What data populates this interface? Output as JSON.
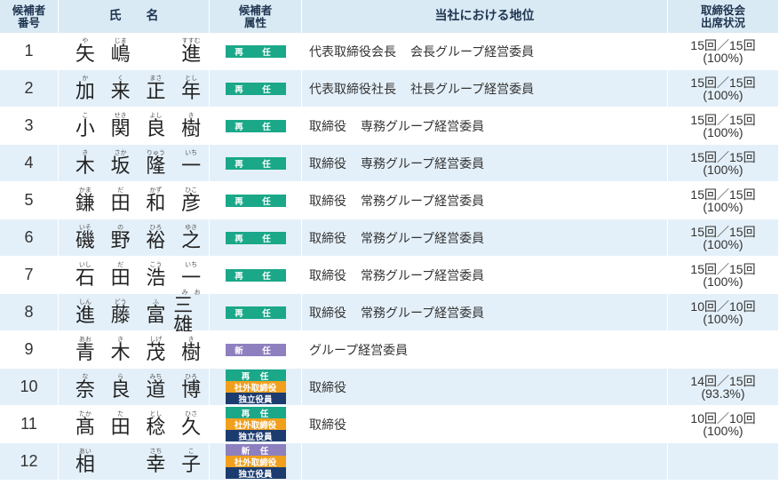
{
  "header": {
    "number_line1": "候補者",
    "number_line2": "番号",
    "name_part1": "氏",
    "name_part2": "名",
    "attr_line1": "候補者",
    "attr_line2": "属性",
    "position": "当社における地位",
    "attendance_line1": "取締役会",
    "attendance_line2": "出席状況"
  },
  "colors": {
    "header_bg": "#d9eaf5",
    "row_alt_bg": "#e4f0f9",
    "reappoint": "#1aa889",
    "new": "#8e7fbf",
    "outside": "#f1a01d",
    "independent": "#1c3c70"
  },
  "rows": [
    {
      "no": "1",
      "name": [
        {
          "k": "矢",
          "r": "や"
        },
        {
          "k": "嶋",
          "r": "じま"
        },
        {
          "k": "",
          "r": ""
        },
        {
          "k": "進",
          "r": "すすむ"
        }
      ],
      "badges": [
        "再　任"
      ],
      "position": [
        "代表取締役会長",
        "会長グループ経営委員"
      ],
      "att1": "15回／15回",
      "att2": "(100%)"
    },
    {
      "no": "2",
      "name": [
        {
          "k": "加",
          "r": "か"
        },
        {
          "k": "来",
          "r": "く"
        },
        {
          "k": "正",
          "r": "まさ"
        },
        {
          "k": "年",
          "r": "とし"
        }
      ],
      "badges": [
        "再　任"
      ],
      "position": [
        "代表取締役社長",
        "社長グループ経営委員"
      ],
      "att1": "15回／15回",
      "att2": "(100%)"
    },
    {
      "no": "3",
      "name": [
        {
          "k": "小",
          "r": "こ"
        },
        {
          "k": "関",
          "r": "せき"
        },
        {
          "k": "良",
          "r": "よし"
        },
        {
          "k": "樹",
          "r": "き"
        }
      ],
      "badges": [
        "再　任"
      ],
      "position": [
        "取締役",
        "専務グループ経営委員"
      ],
      "att1": "15回／15回",
      "att2": "(100%)"
    },
    {
      "no": "4",
      "name": [
        {
          "k": "木",
          "r": "き"
        },
        {
          "k": "坂",
          "r": "さか"
        },
        {
          "k": "隆",
          "r": "りゅう"
        },
        {
          "k": "一",
          "r": "いち"
        }
      ],
      "badges": [
        "再　任"
      ],
      "position": [
        "取締役",
        "専務グループ経営委員"
      ],
      "att1": "15回／15回",
      "att2": "(100%)"
    },
    {
      "no": "5",
      "name": [
        {
          "k": "鎌",
          "r": "かま"
        },
        {
          "k": "田",
          "r": "だ"
        },
        {
          "k": "和",
          "r": "かず"
        },
        {
          "k": "彦",
          "r": "ひこ"
        }
      ],
      "badges": [
        "再　任"
      ],
      "position": [
        "取締役",
        "常務グループ経営委員"
      ],
      "att1": "15回／15回",
      "att2": "(100%)"
    },
    {
      "no": "6",
      "name": [
        {
          "k": "磯",
          "r": "いそ"
        },
        {
          "k": "野",
          "r": "の"
        },
        {
          "k": "裕",
          "r": "ひろ"
        },
        {
          "k": "之",
          "r": "ゆき"
        }
      ],
      "badges": [
        "再　任"
      ],
      "position": [
        "取締役",
        "常務グループ経営委員"
      ],
      "att1": "15回／15回",
      "att2": "(100%)"
    },
    {
      "no": "7",
      "name": [
        {
          "k": "石",
          "r": "いし"
        },
        {
          "k": "田",
          "r": "だ"
        },
        {
          "k": "浩",
          "r": "こう"
        },
        {
          "k": "一",
          "r": "いち"
        }
      ],
      "badges": [
        "再　任"
      ],
      "position": [
        "取締役",
        "常務グループ経営委員"
      ],
      "att1": "15回／15回",
      "att2": "(100%)"
    },
    {
      "no": "8",
      "name": [
        {
          "k": "進",
          "r": "しん"
        },
        {
          "k": "藤",
          "r": "どう"
        },
        {
          "k": "富",
          "r": "ふ"
        },
        {
          "k": "三雄",
          "r": "み　お"
        }
      ],
      "badges": [
        "再　任"
      ],
      "position": [
        "取締役",
        "常務グループ経営委員"
      ],
      "att1": "10回／10回",
      "att2": "(100%)"
    },
    {
      "no": "9",
      "name": [
        {
          "k": "青",
          "r": "あお"
        },
        {
          "k": "木",
          "r": "き"
        },
        {
          "k": "茂",
          "r": "しげ"
        },
        {
          "k": "樹",
          "r": "き"
        }
      ],
      "badges": [
        "新　任"
      ],
      "position": [
        "グループ経営委員"
      ],
      "att1": "",
      "att2": ""
    },
    {
      "no": "10",
      "name": [
        {
          "k": "奈",
          "r": "な"
        },
        {
          "k": "良",
          "r": "ら"
        },
        {
          "k": "道",
          "r": "みち"
        },
        {
          "k": "博",
          "r": "ひろ"
        }
      ],
      "badges": [
        "再　任",
        "社外取締役",
        "独立役員"
      ],
      "position": [
        "取締役"
      ],
      "att1": "14回／15回",
      "att2": "(93.3%)"
    },
    {
      "no": "11",
      "name": [
        {
          "k": "髙",
          "r": "たか"
        },
        {
          "k": "田",
          "r": "た"
        },
        {
          "k": "稔",
          "r": "とし"
        },
        {
          "k": "久",
          "r": "ひさ"
        }
      ],
      "badges": [
        "再　任",
        "社外取締役",
        "独立役員"
      ],
      "position": [
        "取締役"
      ],
      "att1": "10回／10回",
      "att2": "(100%)"
    },
    {
      "no": "12",
      "name": [
        {
          "k": "相",
          "r": "あい"
        },
        {
          "k": "",
          "r": ""
        },
        {
          "k": "幸",
          "r": "さち"
        },
        {
          "k": "子",
          "r": "こ"
        }
      ],
      "badges": [
        "新　任",
        "社外取締役",
        "独立役員"
      ],
      "position": [],
      "att1": "",
      "att2": ""
    }
  ]
}
